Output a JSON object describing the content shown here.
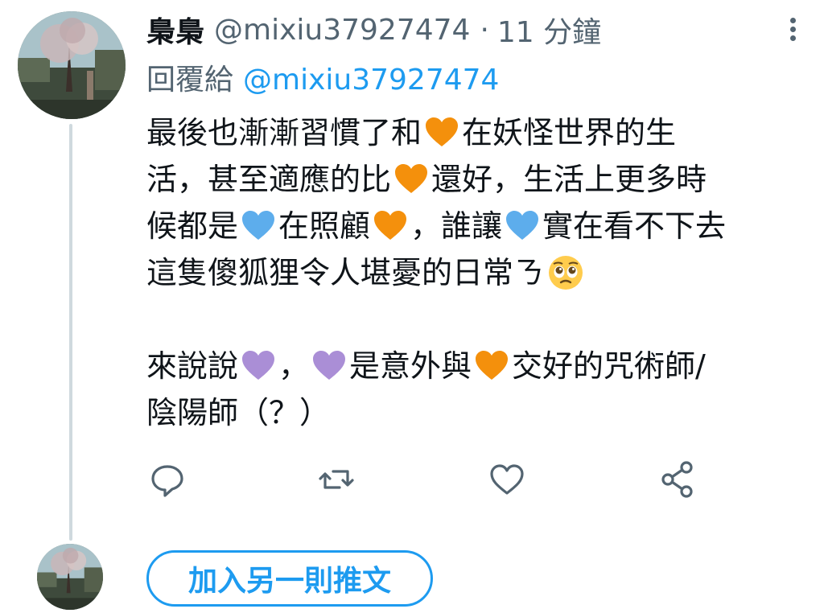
{
  "tweet": {
    "display_name": "梟梟",
    "handle": "@mixiu37927474",
    "separator": "·",
    "time": "11 分鐘",
    "reply_prefix": "回覆給",
    "reply_handle": "@mixiu37927474",
    "lines": {
      "l1a": "最後也漸漸習慣了和",
      "l1b": "在妖怪世界的生",
      "l2a": "活，甚至適應的比",
      "l2b": "還好，生活上更多時",
      "l3a": "候都是",
      "l3b": "在照顧",
      "l3c": "，誰讓",
      "l3d": "實在看不下去",
      "l4a": "這隻傻狐狸令人堪憂的日常ㄋ",
      "l5a": "來說說",
      "l5b": "，",
      "l5c": "是意外與",
      "l5d": "交好的咒術師/",
      "l6a": "陰陽師（？）"
    },
    "emoji": {
      "orange_heart": "orange-heart",
      "blue_heart": "blue-heart",
      "purple_heart": "purple-heart",
      "pleading_face": "pleading-face"
    }
  },
  "actions": {
    "reply_icon": "reply-icon",
    "retweet_icon": "retweet-icon",
    "like_icon": "like-icon",
    "share_icon": "share-icon"
  },
  "composer": {
    "add_tweet_label": "加入另一則推文"
  },
  "colors": {
    "accent": "#1d9bf0",
    "secondary_text": "#536471",
    "orange_heart": "#f4900c",
    "blue_heart": "#5dadec",
    "purple_heart": "#aa8ed6",
    "thread_line": "#cfd9de"
  }
}
